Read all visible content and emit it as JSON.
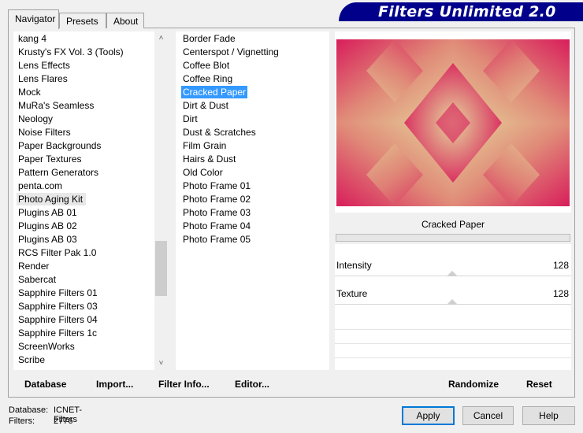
{
  "app": {
    "title": "Filters Unlimited 2.0"
  },
  "tabs": [
    {
      "label": "Navigator",
      "active": true
    },
    {
      "label": "Presets",
      "active": false
    },
    {
      "label": "About",
      "active": false
    }
  ],
  "categories": {
    "items": [
      "kang 4",
      "Krusty's FX Vol. 3 (Tools)",
      "Lens Effects",
      "Lens Flares",
      "Mock",
      "MuRa's Seamless",
      "Neology",
      "Noise Filters",
      "Paper Backgrounds",
      "Paper Textures",
      "Pattern Generators",
      "penta.com",
      "Photo Aging Kit",
      "Plugins AB 01",
      "Plugins AB 02",
      "Plugins AB 03",
      "RCS Filter Pak 1.0",
      "Render",
      "Sabercat",
      "Sapphire Filters 01",
      "Sapphire Filters 03",
      "Sapphire Filters 04",
      "Sapphire Filters 1c",
      "ScreenWorks",
      "Scribe"
    ],
    "current": "Photo Aging Kit",
    "scroll_position": 0.72
  },
  "filters": {
    "items": [
      "Border Fade",
      "Centerspot / Vignetting",
      "Coffee Blot",
      "Coffee Ring",
      "Cracked Paper",
      "Dirt & Dust",
      "Dirt",
      "Dust & Scratches",
      "Film Grain",
      "Hairs & Dust",
      "Old Color",
      "Photo Frame 01",
      "Photo Frame 02",
      "Photo Frame 03",
      "Photo Frame 04",
      "Photo Frame 05"
    ],
    "selected": "Cracked Paper"
  },
  "preview": {
    "filter_name": "Cracked Paper"
  },
  "params": [
    {
      "label": "Intensity",
      "value": "128"
    },
    {
      "label": "Texture",
      "value": "128"
    }
  ],
  "toolbar": {
    "database": "Database",
    "import": "Import...",
    "filter_info": "Filter Info...",
    "editor": "Editor...",
    "randomize": "Randomize",
    "reset": "Reset"
  },
  "status": {
    "database_label": "Database:",
    "database_value": "ICNET-Filters",
    "filters_label": "Filters:",
    "filters_value": "2776"
  },
  "buttons": {
    "apply": "Apply",
    "cancel": "Cancel",
    "help": "Help"
  },
  "colors": {
    "banner": "#00008b",
    "selection": "#3399ff",
    "preview_rose": "#d81e5b",
    "preview_cream": "#e5d59b"
  },
  "icons": {
    "scroll_up": "chevron-up-icon",
    "scroll_down": "chevron-down-icon"
  }
}
